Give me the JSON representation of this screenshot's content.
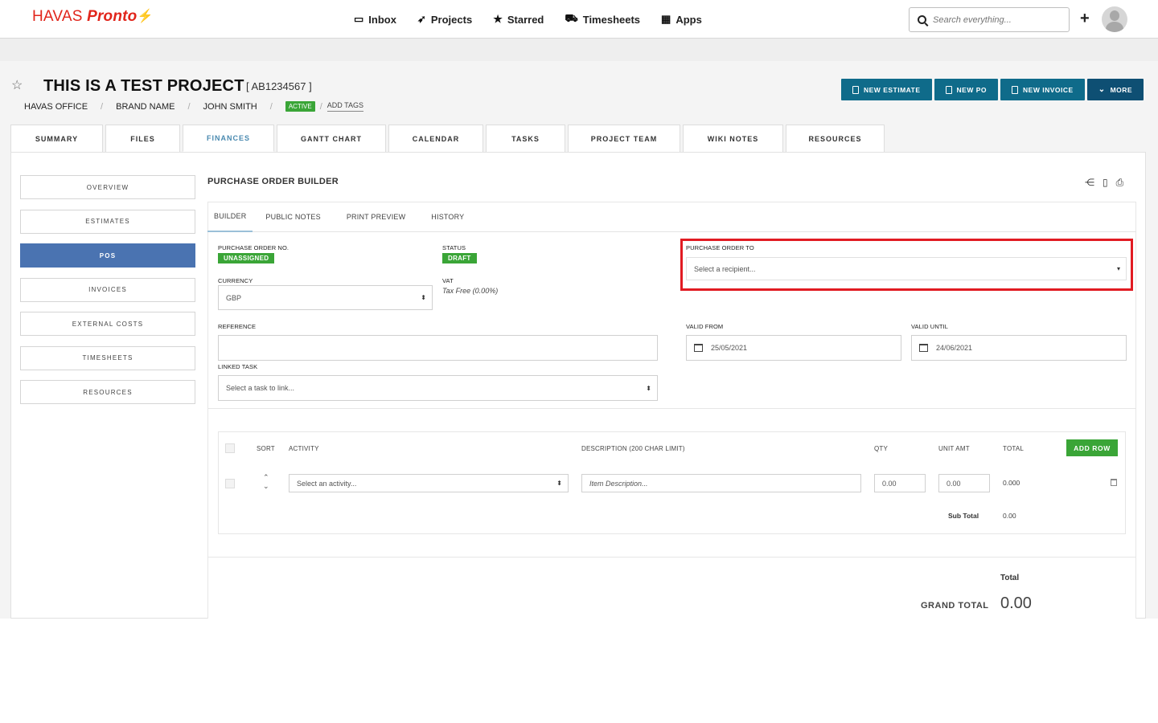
{
  "app": {
    "logo_havas": "HAVAS",
    "logo_pronto": "Pronto",
    "nav": [
      {
        "label": "Inbox",
        "icon": "inbox-icon"
      },
      {
        "label": "Projects",
        "icon": "rocket-icon"
      },
      {
        "label": "Starred",
        "icon": "star-icon"
      },
      {
        "label": "Timesheets",
        "icon": "truck-icon"
      },
      {
        "label": "Apps",
        "icon": "grid-icon"
      }
    ],
    "search_placeholder": "Search everything..."
  },
  "project": {
    "title": "THIS IS A TEST PROJECT",
    "code": "[ AB1234567 ]",
    "office": "HAVAS OFFICE",
    "brand": "BRAND NAME",
    "owner": "JOHN SMITH",
    "status_badge": "ACTIVE",
    "add_tags": "ADD TAGS"
  },
  "actions": {
    "new_estimate": "NEW ESTIMATE",
    "new_po": "NEW PO",
    "new_invoice": "NEW INVOICE",
    "more": "MORE"
  },
  "tabs": [
    "SUMMARY",
    "FILES",
    "FINANCES",
    "GANTT CHART",
    "CALENDAR",
    "TASKS",
    "PROJECT TEAM",
    "WIKI NOTES",
    "RESOURCES"
  ],
  "sidebar": [
    "OVERVIEW",
    "ESTIMATES",
    "POS",
    "INVOICES",
    "EXTERNAL COSTS",
    "TIMESHEETS",
    "RESOURCES"
  ],
  "builder": {
    "title": "PURCHASE ORDER BUILDER",
    "subtabs": [
      "BUILDER",
      "PUBLIC NOTES",
      "PRINT PREVIEW",
      "HISTORY"
    ],
    "po_no_label": "PURCHASE ORDER NO.",
    "po_no_value": "UNASSIGNED",
    "status_label": "STATUS",
    "status_value": "DRAFT",
    "po_to_label": "PURCHASE ORDER TO",
    "po_to_placeholder": "Select a recipient...",
    "currency_label": "CURRENCY",
    "currency_value": "GBP",
    "vat_label": "VAT",
    "vat_value": "Tax Free (0.00%)",
    "reference_label": "REFERENCE",
    "reference_value": "",
    "valid_from_label": "VALID FROM",
    "valid_from_value": "25/05/2021",
    "valid_until_label": "VALID UNTIL",
    "valid_until_value": "24/06/2021",
    "linked_task_label": "LINKED TASK",
    "linked_task_placeholder": "Select a task to link..."
  },
  "items": {
    "headers": {
      "sort": "SORT",
      "activity": "ACTIVITY",
      "description": "DESCRIPTION (200 CHAR LIMIT)",
      "qty": "QTY",
      "unit_amt": "UNIT AMT",
      "total": "TOTAL"
    },
    "add_row": "ADD ROW",
    "row": {
      "activity_placeholder": "Select an activity...",
      "description_placeholder": "Item Description...",
      "qty": "0.00",
      "unit_amt": "0.00",
      "total": "0.000"
    },
    "subtotal_label": "Sub Total",
    "subtotal_value": "0.00"
  },
  "totals": {
    "total_label": "Total",
    "grand_total_label": "GRAND TOTAL",
    "grand_total_value": "0.00"
  },
  "colors": {
    "brand_red": "#e1251b",
    "action_blue": "#0f6b8a",
    "nav_active_blue": "#4a73b1",
    "success_green": "#3aa537",
    "highlight_red": "#e11b22"
  }
}
